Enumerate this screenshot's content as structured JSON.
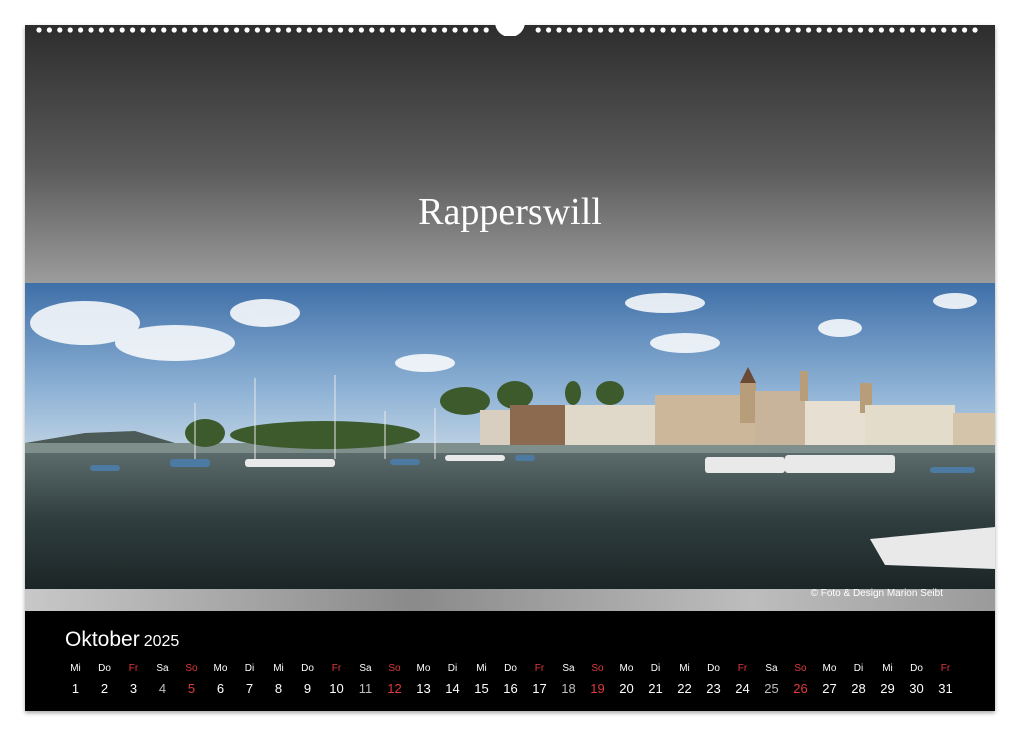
{
  "title": "Rapperswill",
  "photo": {
    "description": ""
  },
  "copyright": "©  Foto & Design Marion Seibt",
  "calendar": {
    "month": "Oktober",
    "year": "2025",
    "days": [
      {
        "wd": "Mi",
        "d": "1"
      },
      {
        "wd": "Do",
        "d": "2"
      },
      {
        "wd": "Fr",
        "d": "3"
      },
      {
        "wd": "Sa",
        "d": "4"
      },
      {
        "wd": "So",
        "d": "5"
      },
      {
        "wd": "Mo",
        "d": "6"
      },
      {
        "wd": "Di",
        "d": "7"
      },
      {
        "wd": "Mi",
        "d": "8"
      },
      {
        "wd": "Do",
        "d": "9"
      },
      {
        "wd": "Fr",
        "d": "10"
      },
      {
        "wd": "Sa",
        "d": "11"
      },
      {
        "wd": "So",
        "d": "12"
      },
      {
        "wd": "Mo",
        "d": "13"
      },
      {
        "wd": "Di",
        "d": "14"
      },
      {
        "wd": "Mi",
        "d": "15"
      },
      {
        "wd": "Do",
        "d": "16"
      },
      {
        "wd": "Fr",
        "d": "17"
      },
      {
        "wd": "Sa",
        "d": "18"
      },
      {
        "wd": "So",
        "d": "19"
      },
      {
        "wd": "Mo",
        "d": "20"
      },
      {
        "wd": "Di",
        "d": "21"
      },
      {
        "wd": "Mi",
        "d": "22"
      },
      {
        "wd": "Do",
        "d": "23"
      },
      {
        "wd": "Fr",
        "d": "24"
      },
      {
        "wd": "Sa",
        "d": "25"
      },
      {
        "wd": "So",
        "d": "26"
      },
      {
        "wd": "Mo",
        "d": "27"
      },
      {
        "wd": "Di",
        "d": "28"
      },
      {
        "wd": "Mi",
        "d": "29"
      },
      {
        "wd": "Do",
        "d": "30"
      },
      {
        "wd": "Fr",
        "d": "31"
      }
    ]
  },
  "colors": {
    "holiday_red": "#e0393b",
    "background": "#000000"
  }
}
